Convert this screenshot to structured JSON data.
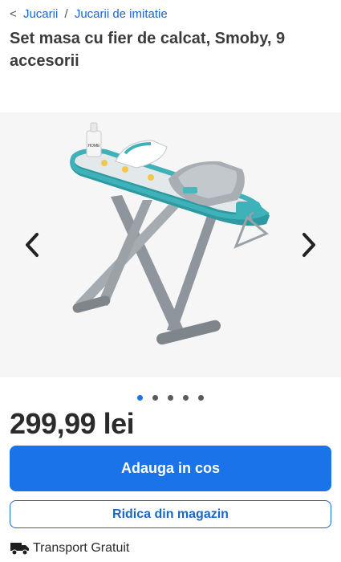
{
  "breadcrumb": {
    "back": "<",
    "items": [
      "Jucarii",
      "Jucarii de imitatie"
    ],
    "separator": "/"
  },
  "product": {
    "title": "Set masa cu fier de calcat, Smoby, 9 accesorii",
    "price": "299,99 lei",
    "bottle_label": "HOME"
  },
  "gallery": {
    "total_images": 5,
    "active_index": 0
  },
  "actions": {
    "add_to_cart": "Adauga in cos",
    "pickup": "Ridica din magazin"
  },
  "shipping": {
    "label": "Transport Gratuit",
    "icon": "truck-icon"
  },
  "colors": {
    "accent": "#1a73e8",
    "link": "#1a66c9",
    "board": "#3eb2b8"
  }
}
